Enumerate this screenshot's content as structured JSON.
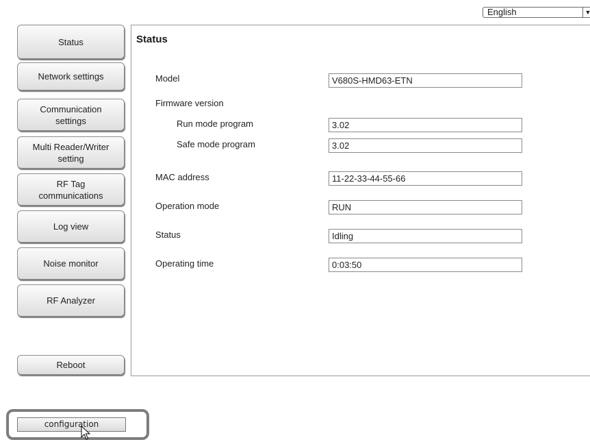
{
  "language": {
    "selected": "English"
  },
  "nav": {
    "status": "Status",
    "network": "Network settings",
    "comm_l1": "Communication",
    "comm_l2": "settings",
    "multi_l1": "Multi Reader/Writer",
    "multi_l2": "setting",
    "rftag_l1": "RF Tag",
    "rftag_l2": "communications",
    "log": "Log view",
    "noise": "Noise monitor",
    "rfanalyzer": "RF Analyzer",
    "reboot": "Reboot"
  },
  "panel": {
    "title": "Status",
    "model_label": "Model",
    "model_value": "V680S-HMD63-ETN",
    "firmware_label": "Firmware version",
    "run_label": "Run mode program",
    "run_value": "3.02",
    "safe_label": "Safe mode program",
    "safe_value": "3.02",
    "mac_label": "MAC address",
    "mac_value": "11-22-33-44-55-66",
    "opmode_label": "Operation mode",
    "opmode_value": "RUN",
    "status_label": "Status",
    "status_value": "Idling",
    "optime_label": "Operating time",
    "optime_value": "0:03:50"
  },
  "config": {
    "label": "configuration"
  }
}
